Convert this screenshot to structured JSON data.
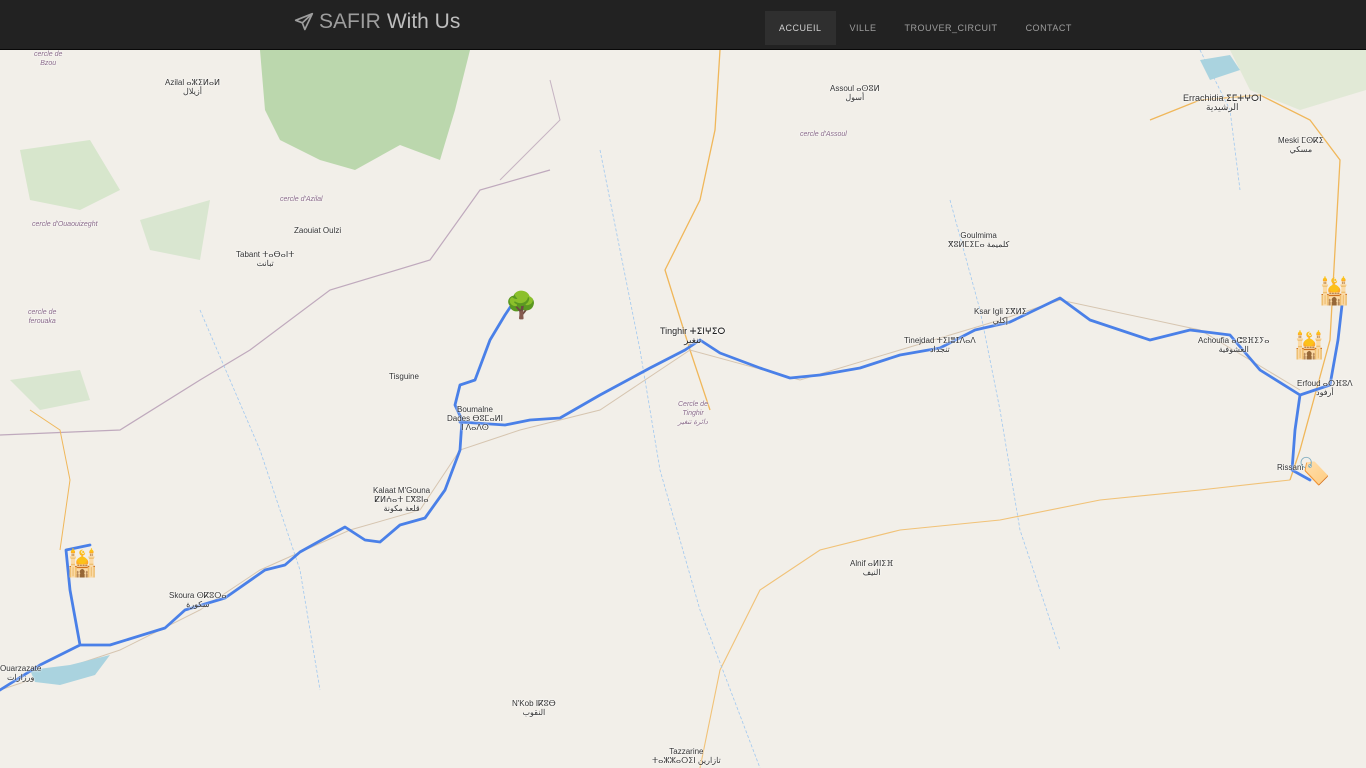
{
  "navbar": {
    "brand_part1": "SAFIR",
    "brand_part2": "With Us",
    "brand_icon": "paper-plane-icon",
    "items": [
      {
        "label": "ACCUEIL",
        "active": true
      },
      {
        "label": "VILLE",
        "active": false
      },
      {
        "label": "TROUVER_CIRCUIT",
        "active": false
      },
      {
        "label": "CONTACT",
        "active": false
      }
    ]
  },
  "map": {
    "route_color": "#4a80e8",
    "places": {
      "errachidia": "Errachidia ⵉⵎⵜⵖⵔⵏ\nالرشيدية",
      "meski": "Meski ⵎⵙⴽⵉ\nمسكي",
      "assoul": "Assoul ⴰⵙⵓⵍ\nأسول",
      "cercle_assoul": "cercle d'Assoul",
      "azilal": "Azilal ⴰⵣⵉⵍⴰⵍ\nأزيلال",
      "cercle_bzou": "cercle de\nBzou",
      "cercle_azilal": "cercle d'Azilal",
      "cercle_ouaouizeght": "cercle d'Ouaouizeght",
      "zaouiat_oulzi": "Zaouiat Oulzi",
      "tabant": "Tabant ⵜⴰⴱⴰⵏⵜ\nتبانت",
      "cercle_ferouaka": "cercle de\nferouaka",
      "goulmima": "Goulmima\nⴳⵓⵍⵎⵉⵎⴰ كلميمة",
      "tinghir": "Tinghir ⵜⵉⵏⵖⵉⵔ\nتنغير",
      "tinejdad": "Tinejdad ⵜⵉⵏⴻⵊⴷⴰⴷ\nتنجداد",
      "ksar_igli": "Ksar Igli ⵉⴳⵍⵉ\nإكلي",
      "achoufia": "Achoufia ⴰⵛⵓⴼⵉⵢⴰ\nالعشوفية",
      "erfoud": "Erfoud ⴰⵔⴼⵓⴷ\nأرفود",
      "rissani": "Rissani",
      "tisguine": "Tisguine",
      "boumalne": "Boumalne\nDades ⴱⵓⵎⴰⵍⵏ\nⵏ ⴷⴰⴷⵙ",
      "cercle_tinghir": "Cercle de\nTinghir\nدائرة تنغير",
      "kelaat": "Kalaat M'Gouna\nⵇⵍⵄⴰⵜ ⵎⴳⵓⵏⴰ\nقلعة مكونة",
      "skoura": "Skoura ⵙⴽⵓⵔⴰ\nسكورة",
      "alnif": "Alnif ⴰⵍⵏⵉⴼ\nالنيف",
      "nkob": "N'Kob ⵏⴽⵓⴱ\nالنقوب",
      "tazzarine": "Tazzarine\nⵜⴰⵣⵣⴰⵔⵉⵏ تازارين",
      "ouarzazate": "Ouarzazate\nورزازات"
    },
    "markers": [
      {
        "name": "tree-marker-icon",
        "glyph": "🌳"
      },
      {
        "name": "mosque-marker-icon",
        "glyph": "🕌"
      },
      {
        "name": "mosque-marker-icon-2",
        "glyph": "🕌"
      },
      {
        "name": "mosque-marker-icon-3",
        "glyph": "🕌"
      },
      {
        "name": "price-tag-marker-icon",
        "glyph": "🏷️"
      }
    ]
  }
}
